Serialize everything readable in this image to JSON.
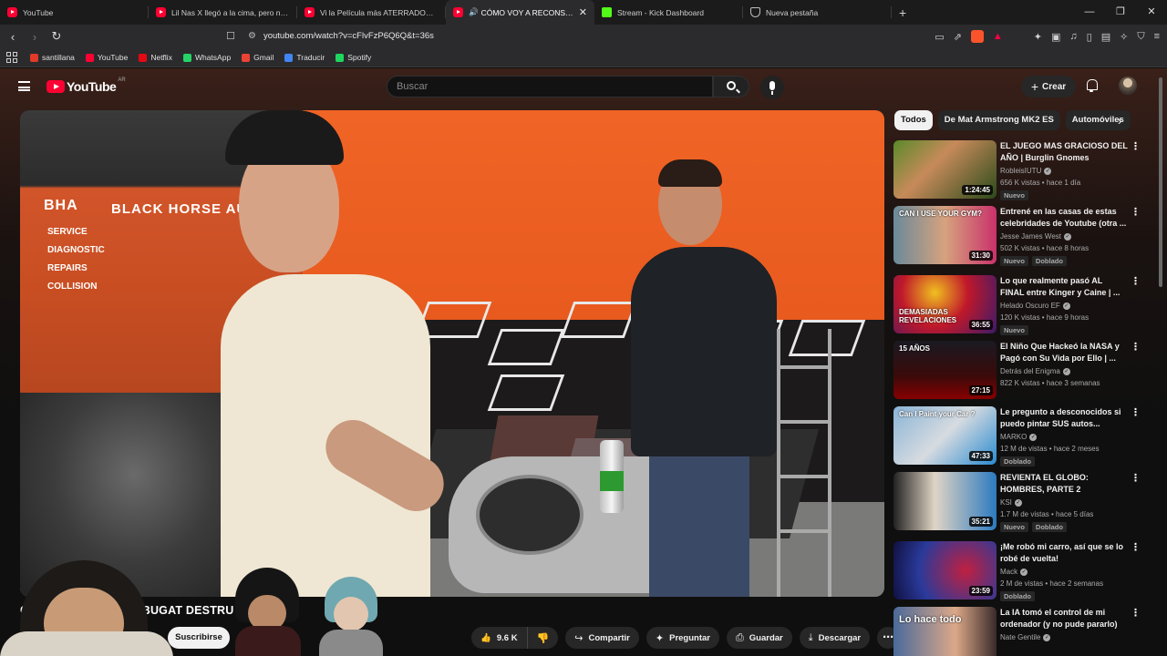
{
  "browser": {
    "tabs": [
      {
        "title": "YouTube",
        "icon": "youtube-icon"
      },
      {
        "title": "Lil Nas X llegó a la cima, pero no supo...",
        "icon": "youtube-icon"
      },
      {
        "title": "Vi la Película más ATERRADORA de O...",
        "icon": "youtube-icon"
      },
      {
        "title": "CÓMO VOY A RECONSTRUIR EL BUGATTI...",
        "icon": "youtube-icon",
        "active": true,
        "audio": "🔊"
      },
      {
        "title": "Stream - Kick Dashboard",
        "icon": "kick-icon"
      },
      {
        "title": "Nueva pestaña",
        "icon": "shield-icon"
      }
    ],
    "new_tab": "+",
    "url": "youtube.com/watch?v=cFlvFzP6Q6Q&t=36s",
    "bookmarks": [
      {
        "label": "santillana",
        "color": "#e03a2a"
      },
      {
        "label": "YouTube",
        "color": "#ff0033"
      },
      {
        "label": "Netflix",
        "color": "#e50914"
      },
      {
        "label": "WhatsApp",
        "color": "#25d366"
      },
      {
        "label": "Gmail",
        "color": "#ea4335"
      },
      {
        "label": "Traducir",
        "color": "#4285f4"
      },
      {
        "label": "Spotify",
        "color": "#1ed760"
      }
    ],
    "brave_badge": "1"
  },
  "youtube": {
    "logo_text": "YouTube",
    "country": "AR",
    "search_placeholder": "Buscar",
    "create_label": "Crear"
  },
  "video": {
    "title": "CÓMO VOY A RECONSTRUIR EL BUGATTI DESTRUIDO",
    "title_visible": "CÓMO        ONSTRUIR EL BUGAT          DESTRU",
    "shop_sign": "BLACK HORSE AU",
    "shop_sign_left": "BHA",
    "shop_services": [
      "SERVICE",
      "DIAGNOSTIC",
      "REPAIRS",
      "COLLISION"
    ],
    "subscribe_label": "Suscribirse",
    "like_count": "9.6 K",
    "share_label": "Compartir",
    "ask_label": "Preguntar",
    "save_label": "Guardar",
    "download_label": "Descargar"
  },
  "chips": [
    "Todos",
    "De Mat Armstrong MK2 ES",
    "Automóviles"
  ],
  "recommendations": [
    {
      "title": "EL JUEGO MAS GRACIOSO DEL AÑO | Burglin Gnomes",
      "channel": "RobleisIUTU",
      "meta": "656 K vistas • hace 1 día",
      "duration": "1:24:45",
      "badges": [
        "Nuevo"
      ],
      "thumb_text": ""
    },
    {
      "title": "Entrené en las casas de estas celebridades de Youtube (otra ...",
      "channel": "Jesse James West",
      "meta": "502 K vistas • hace 8 horas",
      "duration": "31:30",
      "badges": [
        "Nuevo",
        "Doblado"
      ],
      "thumb_text": "CAN I USE YOUR GYM?"
    },
    {
      "title": "Lo que realmente pasó AL FINAL entre Kinger y Caine | ...",
      "channel": "Helado Oscuro EF",
      "meta": "120 K vistas • hace 9 horas",
      "duration": "36:55",
      "badges": [
        "Nuevo"
      ],
      "thumb_text": "DEMASIADAS REVELACIONES"
    },
    {
      "title": "El Niño Que Hackeó la NASA y Pagó con Su Vida por Ello | ...",
      "channel": "Detrás del Enigma",
      "meta": "822 K vistas • hace 3 semanas",
      "duration": "27:15",
      "badges": [],
      "thumb_text": "15 AÑOS"
    },
    {
      "title": "Le pregunto a desconocidos si puedo pintar SUS autos...",
      "channel": "MARKO",
      "meta": "12 M de vistas • hace 2 meses",
      "duration": "47:33",
      "badges": [
        "Doblado"
      ],
      "thumb_text": "Can I Paint your Car ?"
    },
    {
      "title": "REVIENTA EL GLOBO: HOMBRES, PARTE 2",
      "channel": "KSI",
      "meta": "1.7 M de vistas • hace 5 días",
      "duration": "35:21",
      "badges": [
        "Nuevo",
        "Doblado"
      ],
      "thumb_text": ""
    },
    {
      "title": "¡Me robó mi carro, así que se lo robé de vuelta!",
      "channel": "Mack",
      "meta": "2 M de vistas • hace 2 semanas",
      "duration": "23:59",
      "badges": [
        "Doblado"
      ],
      "thumb_text": ""
    },
    {
      "title": "La IA tomó el control de mi ordenador (y no pude pararlo)",
      "channel": "Nate Gentile",
      "meta": "",
      "duration": "",
      "badges": [],
      "thumb_text": "Lo hace todo"
    }
  ]
}
